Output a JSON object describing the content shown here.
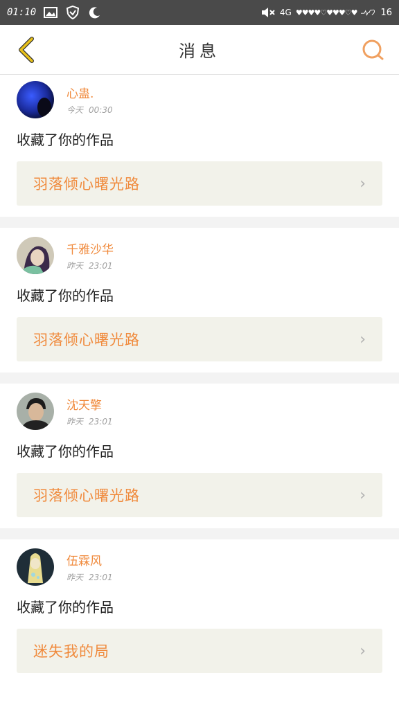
{
  "status_bar": {
    "time": "01:10",
    "network": "4G",
    "hearts": "♥♥♥♥♡♥♥♥♡♥",
    "battery": "16"
  },
  "header": {
    "title": "消息",
    "back_icon": "chevron-left-icon",
    "search_icon": "search-icon"
  },
  "colors": {
    "accent": "#f08a3c",
    "back_icon": "#e8c11a",
    "link_bg": "#f2f2ea"
  },
  "items": [
    {
      "name": "心蛊.",
      "day": "今天",
      "time": "00:30",
      "action": "收藏了你的作品",
      "work": "羽落倾心曙光路"
    },
    {
      "name": "千雅沙华",
      "day": "昨天",
      "time": "23:01",
      "action": "收藏了你的作品",
      "work": "羽落倾心曙光路"
    },
    {
      "name": "沈天擎",
      "day": "昨天",
      "time": "23:01",
      "action": "收藏了你的作品",
      "work": "羽落倾心曙光路"
    },
    {
      "name": "伍霖风",
      "day": "昨天",
      "time": "23:01",
      "action": "收藏了你的作品",
      "work": "迷失我的局"
    }
  ]
}
